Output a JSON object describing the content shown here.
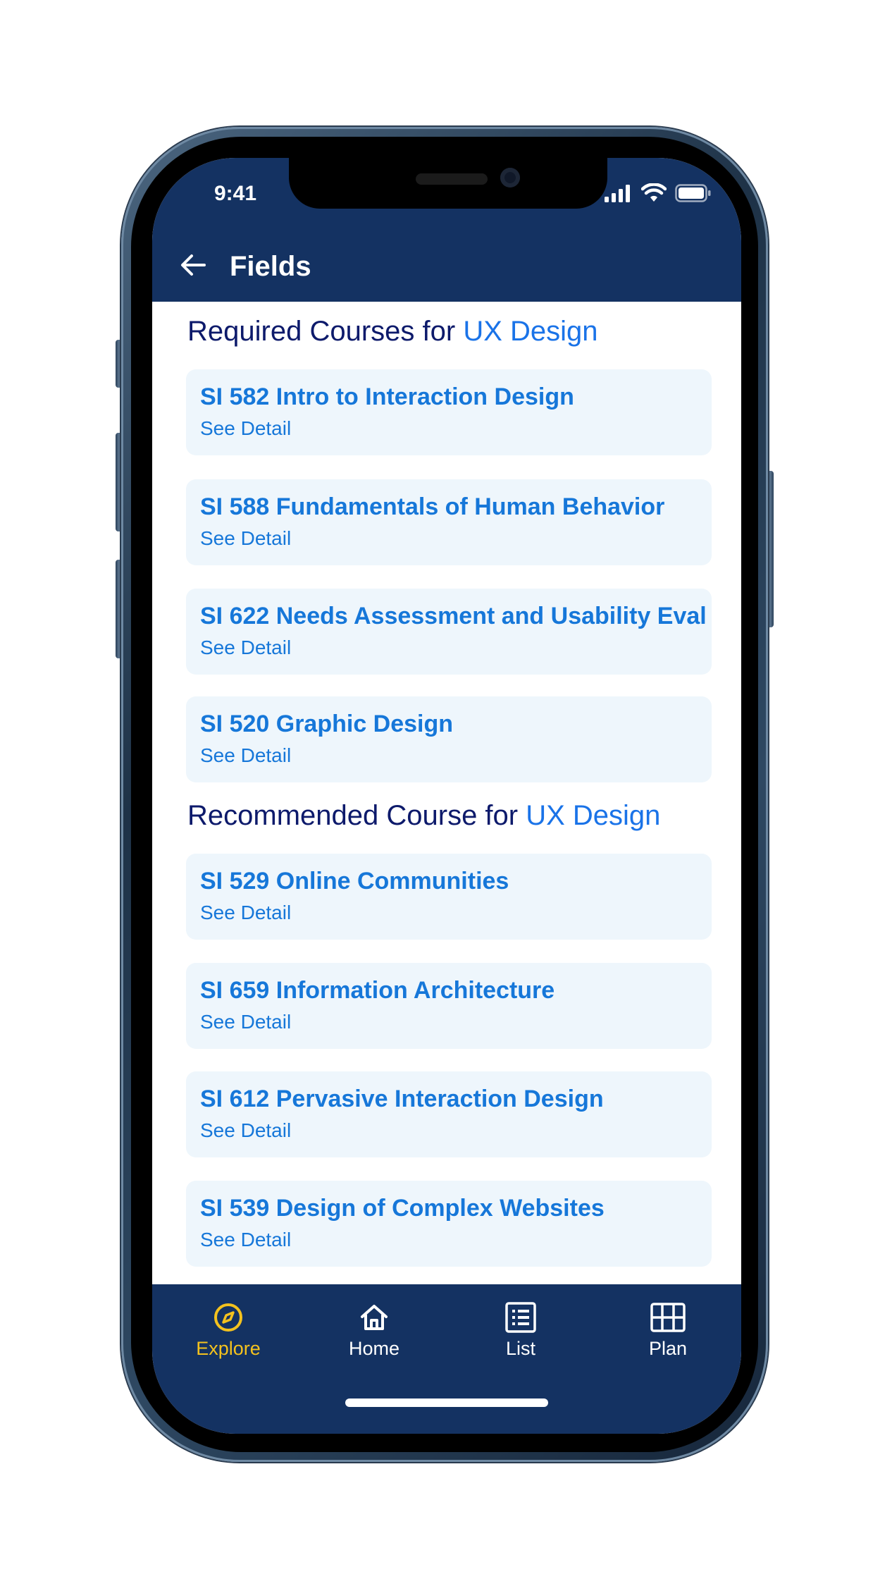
{
  "status_bar": {
    "time": "9:41"
  },
  "header": {
    "title": "Fields"
  },
  "required_section": {
    "prefix": "Required Courses for",
    "field": "UX Design",
    "courses": [
      {
        "title": "SI 582 Intro to Interaction Design",
        "link": "See Detail"
      },
      {
        "title": "SI 588 Fundamentals of Human Behavior",
        "link": "See Detail"
      },
      {
        "title": "SI 622 Needs Assessment and Usability Eval",
        "link": "See Detail"
      },
      {
        "title": "SI 520 Graphic Design",
        "link": "See Detail"
      }
    ]
  },
  "recommended_section": {
    "prefix": "Recommended Course for",
    "field": "UX Design",
    "courses": [
      {
        "title": "SI 529 Online Communities",
        "link": "See Detail"
      },
      {
        "title": "SI 659 Information Architecture",
        "link": "See Detail"
      },
      {
        "title": "SI 612 Pervasive Interaction Design",
        "link": "See Detail"
      },
      {
        "title": "SI 539 Design of Complex Websites",
        "link": "See Detail"
      }
    ]
  },
  "bottom_nav": {
    "items": [
      {
        "label": "Explore",
        "icon": "compass-icon",
        "active": true
      },
      {
        "label": "Home",
        "icon": "home-icon",
        "active": false
      },
      {
        "label": "List",
        "icon": "list-icon",
        "active": false
      },
      {
        "label": "Plan",
        "icon": "grid-icon",
        "active": false
      }
    ]
  },
  "colors": {
    "brand_navy": "#143262",
    "accent_blue": "#1a73e8",
    "card_bg": "#eef6fc",
    "active_nav": "#f4c21e"
  }
}
